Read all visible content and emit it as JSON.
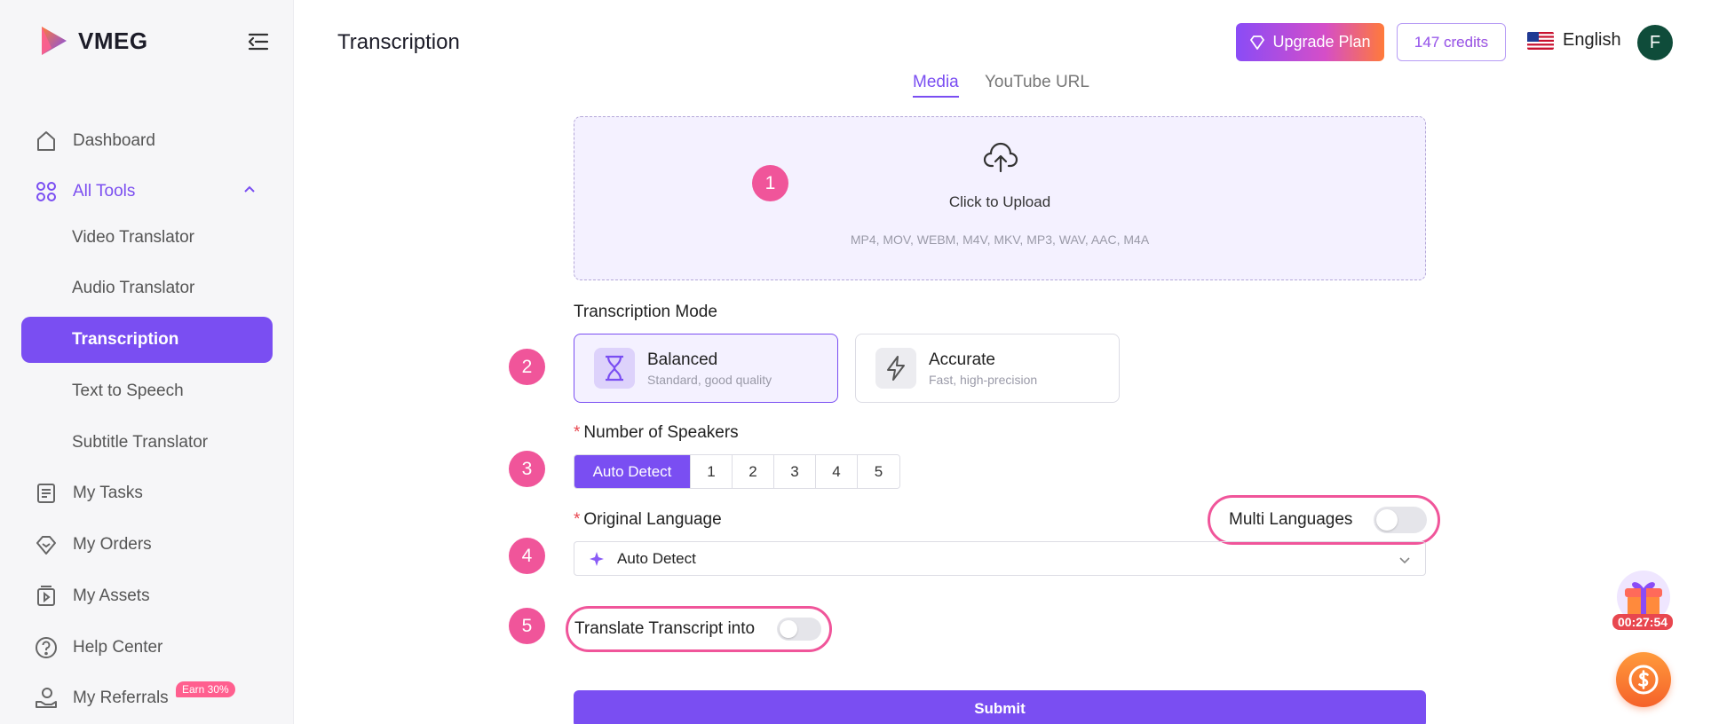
{
  "brand": {
    "name": "VMEG"
  },
  "sidebar": {
    "items": [
      {
        "label": "Dashboard",
        "icon": "home-icon"
      },
      {
        "label": "All Tools",
        "icon": "grid-icon"
      },
      {
        "label": "My Tasks",
        "icon": "tasks-icon"
      },
      {
        "label": "My Orders",
        "icon": "orders-icon"
      },
      {
        "label": "My Assets",
        "icon": "assets-icon"
      },
      {
        "label": "Help Center",
        "icon": "help-icon"
      },
      {
        "label": "My Referrals",
        "icon": "referrals-icon",
        "badge": "Earn 30%"
      }
    ],
    "tools": [
      "Video Translator",
      "Audio Translator",
      "Transcription",
      "Text to Speech",
      "Subtitle Translator"
    ],
    "active_tool": "Transcription"
  },
  "header": {
    "title": "Transcription",
    "upgrade_label": "Upgrade Plan",
    "credits_label": "147 credits",
    "language": "English",
    "avatar_initial": "F"
  },
  "tabs": [
    {
      "label": "Media",
      "active": true
    },
    {
      "label": "YouTube URL",
      "active": false
    }
  ],
  "upload": {
    "label": "Click to Upload",
    "formats": "MP4, MOV, WEBM, M4V, MKV, MP3, WAV, AAC, M4A"
  },
  "steps": [
    "1",
    "2",
    "3",
    "4",
    "5"
  ],
  "mode": {
    "label": "Transcription Mode",
    "options": [
      {
        "title": "Balanced",
        "subtitle": "Standard, good quality",
        "selected": true
      },
      {
        "title": "Accurate",
        "subtitle": "Fast, high-precision",
        "selected": false
      }
    ]
  },
  "speakers": {
    "label": "Number of Speakers",
    "options": [
      "Auto Detect",
      "1",
      "2",
      "3",
      "4",
      "5"
    ],
    "selected": "Auto Detect"
  },
  "language": {
    "label": "Original Language",
    "multi_label": "Multi Languages",
    "multi_enabled": false,
    "value": "Auto Detect"
  },
  "translate": {
    "label": "Translate Transcript into",
    "enabled": false
  },
  "submit_label": "Submit",
  "timer": "00:27:54",
  "colors": {
    "accent": "#7a4ef2",
    "step_pink": "#f0559a",
    "upload_bg": "#f4f1ff"
  }
}
